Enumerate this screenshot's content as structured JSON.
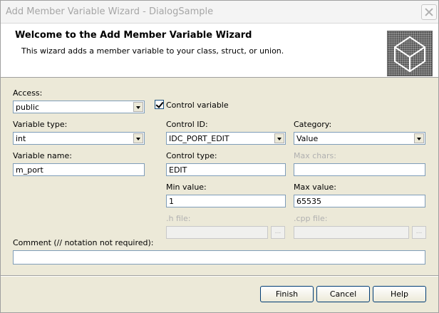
{
  "window": {
    "title": "Add Member Variable Wizard - DialogSample"
  },
  "header": {
    "title": "Welcome to the Add Member Variable Wizard",
    "description": "This wizard adds a member variable to your class, struct, or union."
  },
  "form": {
    "access": {
      "label": "Access:",
      "value": "public"
    },
    "control_variable": {
      "label": "Control variable",
      "checked": true
    },
    "variable_type": {
      "label": "Variable type:",
      "value": "int"
    },
    "variable_name": {
      "label": "Variable name:",
      "value": "m_port"
    },
    "control_id": {
      "label": "Control ID:",
      "value": "IDC_PORT_EDIT"
    },
    "control_type": {
      "label": "Control type:",
      "value": "EDIT"
    },
    "min_value": {
      "label": "Min value:",
      "value": "1"
    },
    "h_file": {
      "label": ".h file:",
      "value": "",
      "browse": "..."
    },
    "category": {
      "label": "Category:",
      "value": "Value"
    },
    "max_chars": {
      "label": "Max chars:",
      "value": ""
    },
    "max_value": {
      "label": "Max value:",
      "value": "65535"
    },
    "cpp_file": {
      "label": ".cpp file:",
      "value": "",
      "browse": "..."
    },
    "comment": {
      "label": "Comment (// notation not required):",
      "value": ""
    }
  },
  "buttons": {
    "finish": "Finish",
    "cancel": "Cancel",
    "help": "Help"
  }
}
